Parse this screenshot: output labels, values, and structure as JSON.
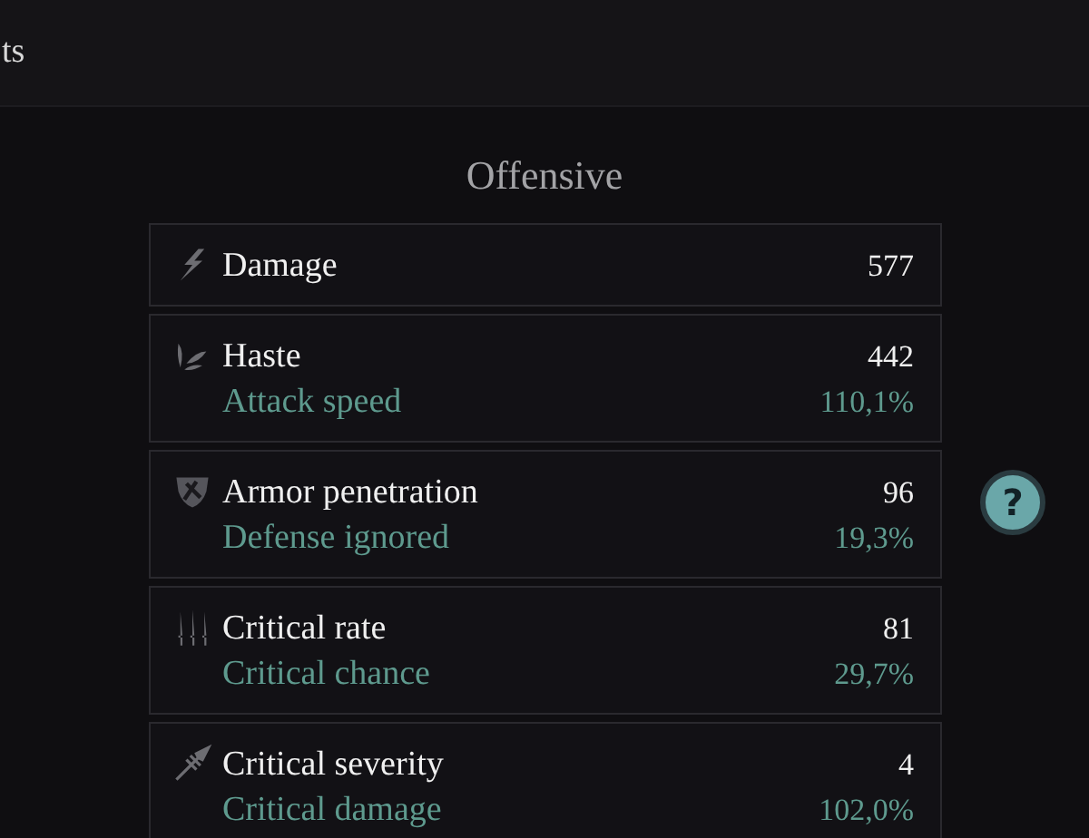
{
  "header": {
    "title": "ts"
  },
  "section": {
    "title": "Offensive"
  },
  "stats": [
    {
      "name": "Damage",
      "value": "577"
    },
    {
      "name": "Haste",
      "value": "442",
      "sub_label": "Attack speed",
      "sub_value": "110,1%"
    },
    {
      "name": "Armor penetration",
      "value": "96",
      "sub_label": "Defense ignored",
      "sub_value": "19,3%"
    },
    {
      "name": "Critical rate",
      "value": "81",
      "sub_label": "Critical chance",
      "sub_value": "29,7%"
    },
    {
      "name": "Critical severity",
      "value": "4",
      "sub_label": "Critical damage",
      "sub_value": "102,0%"
    }
  ],
  "help_button": {
    "label": "?"
  }
}
